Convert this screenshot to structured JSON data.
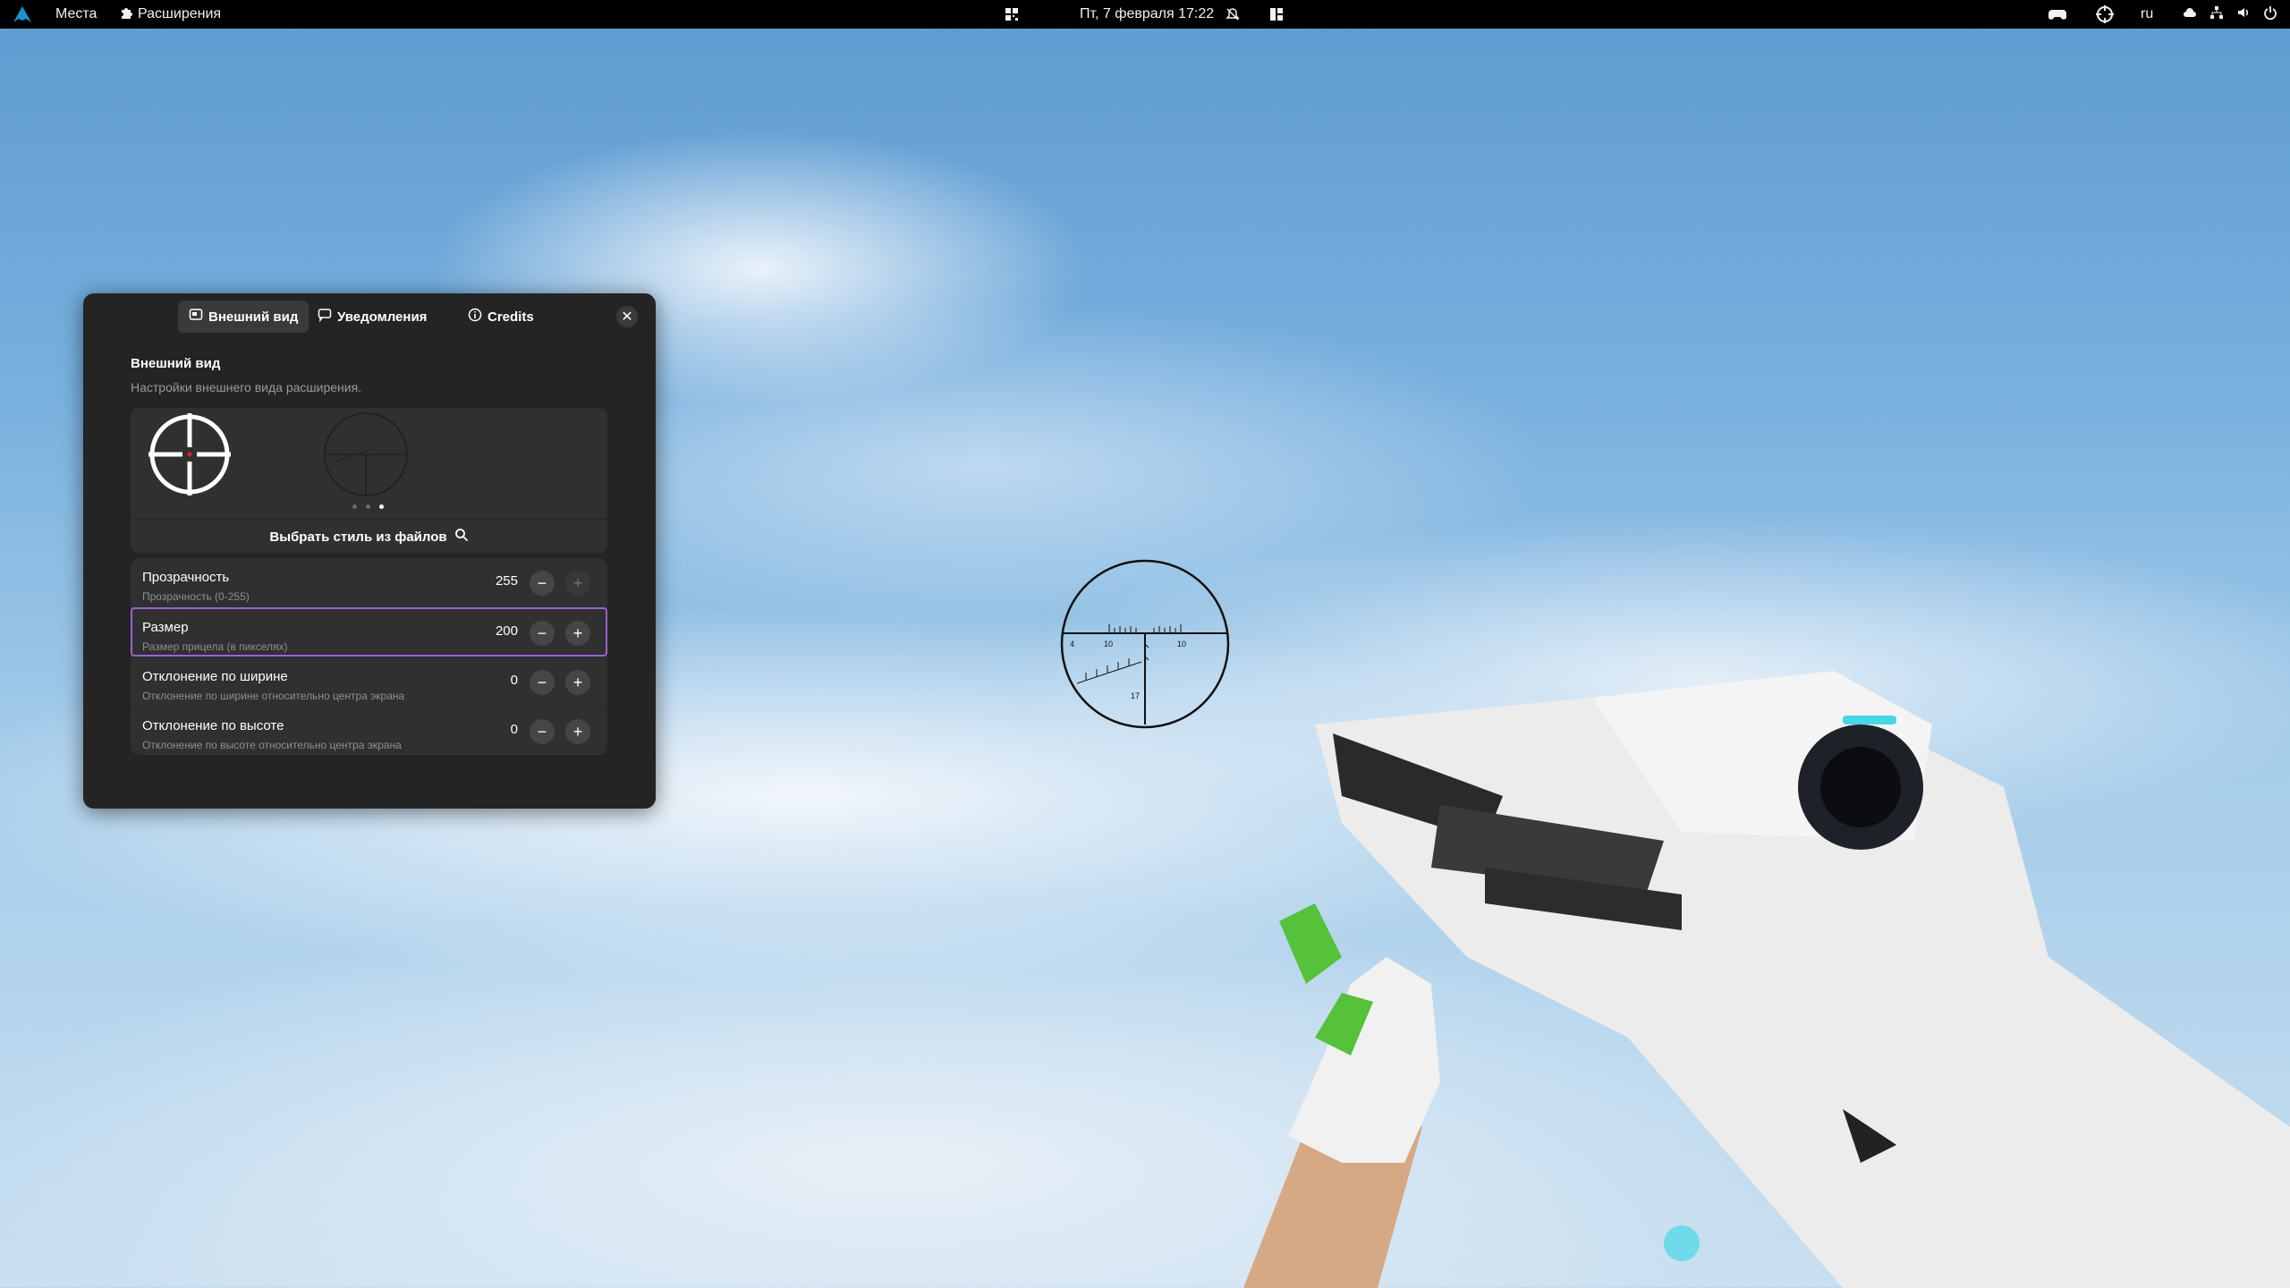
{
  "topbar": {
    "places_label": "Места",
    "extensions_label": "Расширения",
    "datetime": "Пт, 7 февраля  17:22",
    "language": "ru"
  },
  "window": {
    "tabs": [
      {
        "label": "Внешний вид",
        "icon": "appearance-icon",
        "active": true
      },
      {
        "label": "Уведомления",
        "icon": "notification-icon",
        "active": false
      },
      {
        "label": "Credits",
        "icon": "info-icon",
        "active": false
      }
    ],
    "section_title": "Внешний вид",
    "section_subtitle": "Настройки внешнего вида расширения.",
    "carousel_page": "3 of 3",
    "choose_style_label": "Выбрать стиль из файлов",
    "rows": [
      {
        "label": "Прозрачность",
        "subtitle": "Прозрачность (0-255)",
        "value": "255"
      },
      {
        "label": "Размер",
        "subtitle": "Размер прицела (в пикселях)",
        "value": "200"
      },
      {
        "label": "Отклонение по ширине",
        "subtitle": "Отклонение по ширине относительно центра экрана",
        "value": "0"
      },
      {
        "label": "Отклонение по высоте",
        "subtitle": "Отклонение по высоте относительно центра экрана",
        "value": "0"
      }
    ]
  },
  "scope": {
    "left_tick": "4",
    "tick_10_left": "10",
    "tick_10_right": "10",
    "bottom_value": "17"
  },
  "colors": {
    "accent": "#9a62d6",
    "window_bg": "#242424",
    "card_bg": "#303030",
    "crosshair_dot": "#e02020"
  }
}
